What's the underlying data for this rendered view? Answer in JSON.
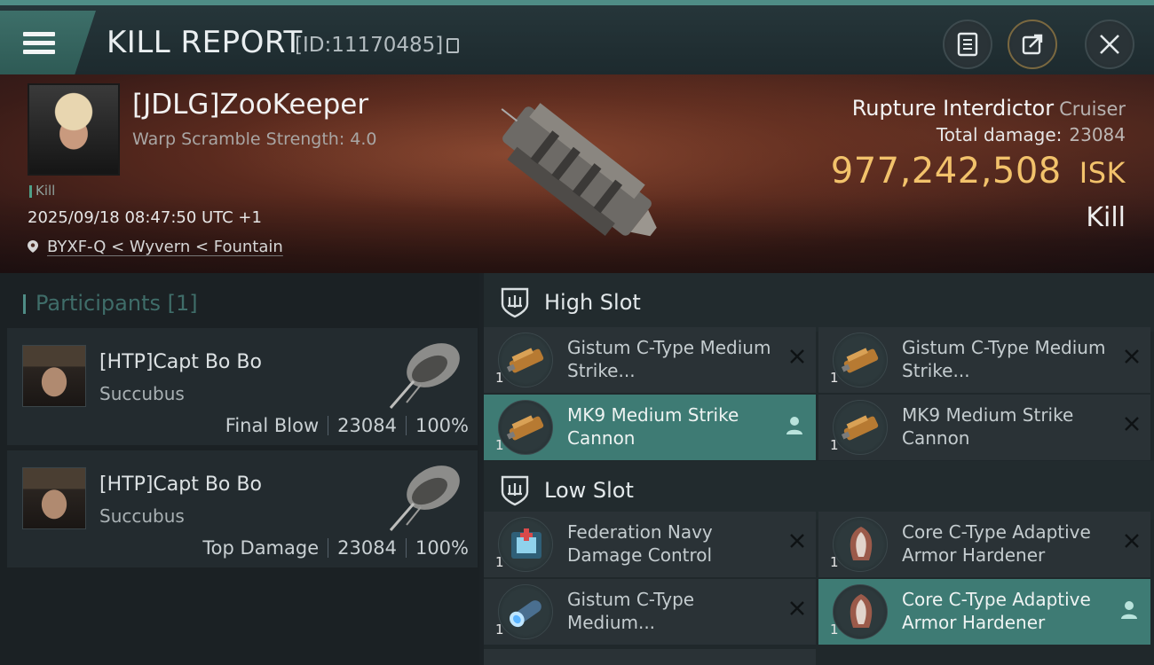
{
  "header": {
    "title": "KILL REPORT",
    "report_id": "[ID:11170485]",
    "buttons": [
      "document-icon",
      "share-icon",
      "close-icon"
    ]
  },
  "victim": {
    "name": "[JDLG]ZooKeeper",
    "subtitle": "Warp Scramble Strength: 4.0",
    "tag": "Kill",
    "datetime": "2025/09/18 08:47:50 UTC +1",
    "location": "BYXF-Q < Wyvern < Fountain",
    "ship_name": "Rupture Interdictor",
    "ship_class": "Cruiser",
    "total_damage_label": "Total damage:",
    "total_damage": "23084",
    "isk_value": "977,242,508",
    "isk_unit": "ISK",
    "result": "Kill"
  },
  "participants": {
    "title": "Participants",
    "count": "[1]",
    "items": [
      {
        "name": "[HTP]Capt Bo Bo",
        "ship": "Succubus",
        "role": "Final Blow",
        "damage": "23084",
        "percent": "100%"
      },
      {
        "name": "[HTP]Capt Bo Bo",
        "ship": "Succubus",
        "role": "Top Damage",
        "damage": "23084",
        "percent": "100%"
      }
    ]
  },
  "slots": {
    "high": {
      "label": "High Slot",
      "modules": [
        {
          "name": "Gistum C-Type Medium Strike...",
          "qty": "1"
        },
        {
          "name": "Gistum C-Type Medium Strike...",
          "qty": "1"
        },
        {
          "name": "MK9 Medium Strike Cannon",
          "qty": "1"
        },
        {
          "name": "MK9 Medium Strike Cannon",
          "qty": "1"
        }
      ]
    },
    "low": {
      "label": "Low Slot",
      "modules": [
        {
          "name": "Federation Navy Damage Control",
          "qty": "1"
        },
        {
          "name": "Core C-Type Adaptive Armor Hardener",
          "qty": "1"
        },
        {
          "name": "Gistum C-Type Medium...",
          "qty": "1"
        },
        {
          "name": "Core C-Type Adaptive Armor Hardener",
          "qty": "1"
        }
      ]
    }
  },
  "colors": {
    "accent": "#4f8d86",
    "isk": "#f2c26b",
    "active_row": "#3e7b74"
  }
}
